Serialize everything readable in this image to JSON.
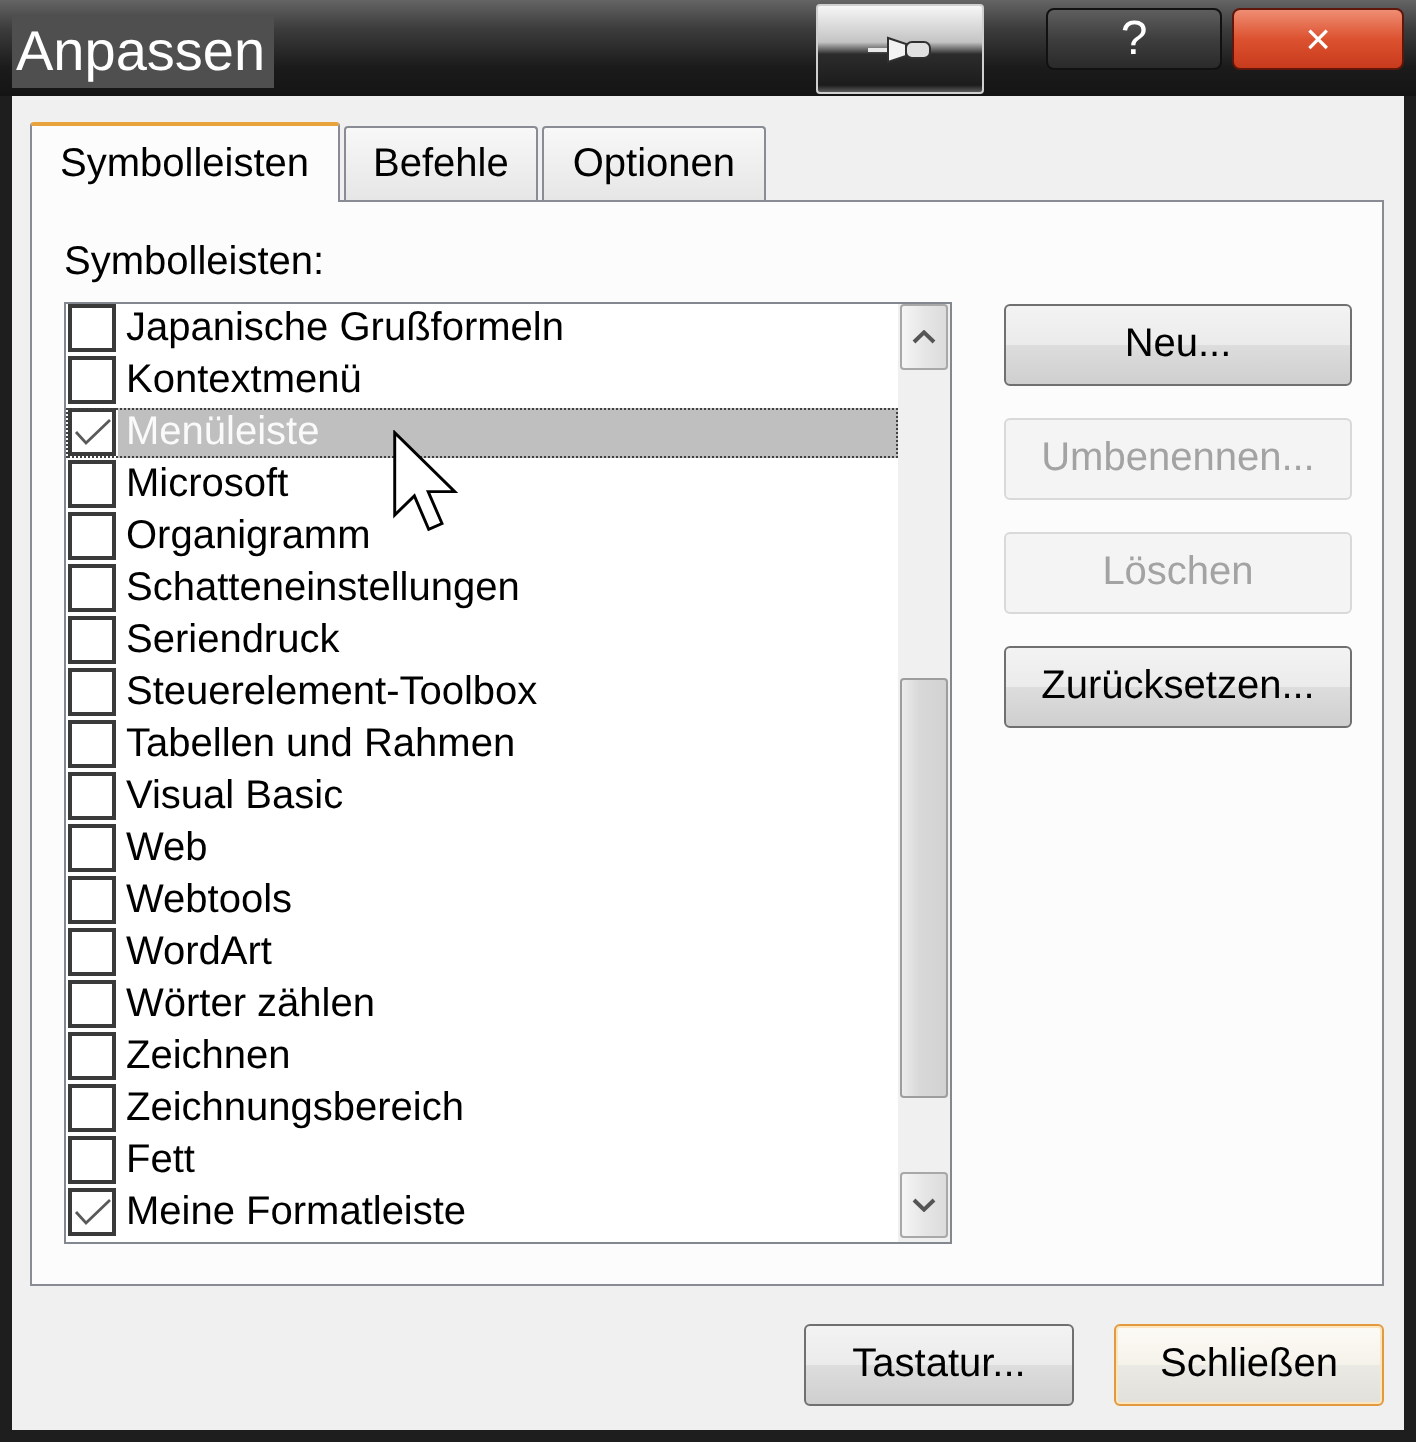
{
  "window": {
    "title": "Anpassen"
  },
  "title_buttons": [
    {
      "kind": "pin"
    },
    {
      "kind": "help",
      "label": "?"
    },
    {
      "kind": "close",
      "label": "×"
    }
  ],
  "tabs": [
    {
      "label": "Symbolleisten",
      "selected": true
    },
    {
      "label": "Befehle",
      "selected": false
    },
    {
      "label": "Optionen",
      "selected": false
    }
  ],
  "panel": {
    "label": "Symbolleisten:",
    "items": [
      {
        "label": "Japanische Grußformeln",
        "checked": false,
        "selected": false
      },
      {
        "label": "Kontextmenü",
        "checked": false,
        "selected": false
      },
      {
        "label": "Menüleiste",
        "checked": true,
        "selected": true
      },
      {
        "label": "Microsoft",
        "checked": false,
        "selected": false
      },
      {
        "label": "Organigramm",
        "checked": false,
        "selected": false
      },
      {
        "label": "Schatteneinstellungen",
        "checked": false,
        "selected": false
      },
      {
        "label": "Seriendruck",
        "checked": false,
        "selected": false
      },
      {
        "label": "Steuerelement-Toolbox",
        "checked": false,
        "selected": false
      },
      {
        "label": "Tabellen und Rahmen",
        "checked": false,
        "selected": false
      },
      {
        "label": "Visual Basic",
        "checked": false,
        "selected": false
      },
      {
        "label": "Web",
        "checked": false,
        "selected": false
      },
      {
        "label": "Webtools",
        "checked": false,
        "selected": false
      },
      {
        "label": "WordArt",
        "checked": false,
        "selected": false
      },
      {
        "label": "Wörter zählen",
        "checked": false,
        "selected": false
      },
      {
        "label": "Zeichnen",
        "checked": false,
        "selected": false
      },
      {
        "label": "Zeichnungsbereich",
        "checked": false,
        "selected": false
      },
      {
        "label": "Fett",
        "checked": false,
        "selected": false
      },
      {
        "label": "Meine Formatleiste",
        "checked": true,
        "selected": false
      }
    ],
    "buttons": [
      {
        "label": "Neu...",
        "disabled": false
      },
      {
        "label": "Umbenennen...",
        "disabled": true
      },
      {
        "label": "Löschen",
        "disabled": true
      },
      {
        "label": "Zurücksetzen...",
        "disabled": false
      }
    ]
  },
  "mouse_cursor": {
    "kind": "arrow"
  },
  "footer_buttons": [
    {
      "label": "Tastatur...",
      "default": false
    },
    {
      "label": "Schließen",
      "default": true
    }
  ]
}
